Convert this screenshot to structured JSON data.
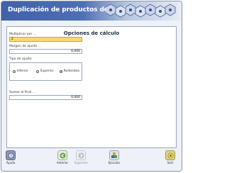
{
  "window": {
    "title": "Duplicación de productos de tarifas."
  },
  "main": {
    "heading": "Opciones de cálculo",
    "multiplicar": {
      "label": "Multiplicar por ...",
      "value": "2"
    },
    "margen": {
      "label": "Margen de ajuste ...",
      "value": "0,000"
    },
    "tipo": {
      "label": "Tipo de ajuste",
      "options": [
        {
          "label": "Inferior",
          "selected": false
        },
        {
          "label": "Superior",
          "selected": false
        },
        {
          "label": "Redondeo",
          "selected": true
        }
      ]
    },
    "sumar": {
      "label": "Sumar al final ...",
      "value": "0,000"
    }
  },
  "footer": {
    "help_label": "Ayuda",
    "prev_label": "Anterior",
    "next_label": "Siguiente",
    "run_label": "Ejecutar",
    "exit_label": "Salir"
  },
  "colors": {
    "title_bar": "#3f62a8",
    "highlight_field": "#f7d96a",
    "panel": "#eef1f7"
  }
}
